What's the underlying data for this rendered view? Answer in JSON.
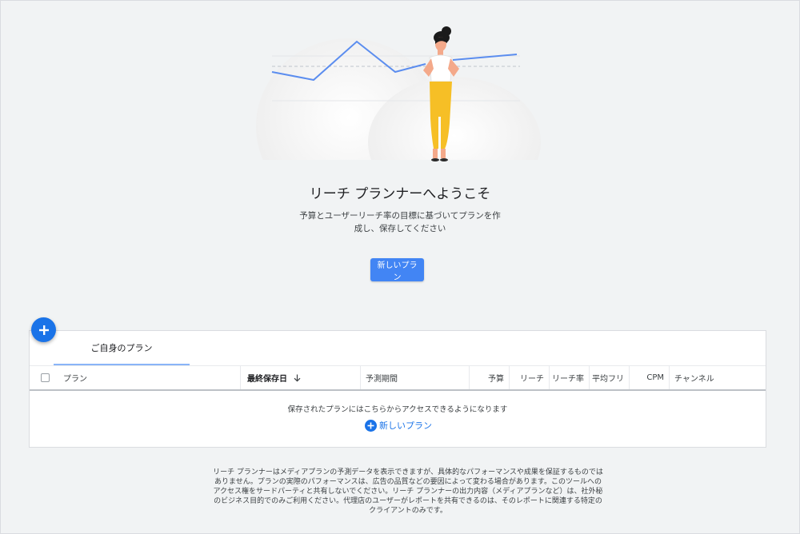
{
  "hero": {
    "title": "リーチ プランナーへようこそ",
    "subtitle": "予算とユーザーリーチ率の目標に基づいてプランを作成し、保存してください",
    "button_label": "新しいプラン"
  },
  "fab": {
    "icon": "plus-icon"
  },
  "plans": {
    "tab_label": "ご自身のプラン",
    "columns": [
      "プラン",
      "最終保存日",
      "予測期間",
      "予算",
      "リーチ",
      "リーチ率",
      "平均フリ",
      "CPM",
      "チャンネル"
    ],
    "sort_icon": "arrow-down-icon",
    "empty_message": "保存されたプランにはこちらからアクセスできるようになります",
    "new_plan_label": "新しいプラン"
  },
  "disclaimer": "リーチ プランナーはメディアプランの予測データを表示できますが、具体的なパフォーマンスや成果を保証するものではありません。プランの実際のパフォーマンスは、広告の品質などの要因によって変わる場合があります。このツールへのアクセス権をサードパーティと共有しないでください。リーチ プランナーの出力内容（メディアプランなど）は、社外秘のビジネス目的でのみご利用ください。代理店のユーザーがレポートを共有できるのは、そのレポートに関連する特定のクライアントのみです。",
  "colors": {
    "accent": "#1a73e8",
    "button": "#4285f4",
    "background": "#f1f3f4",
    "chart_line": "#5b8def",
    "figure_pants": "#f6bf26"
  }
}
